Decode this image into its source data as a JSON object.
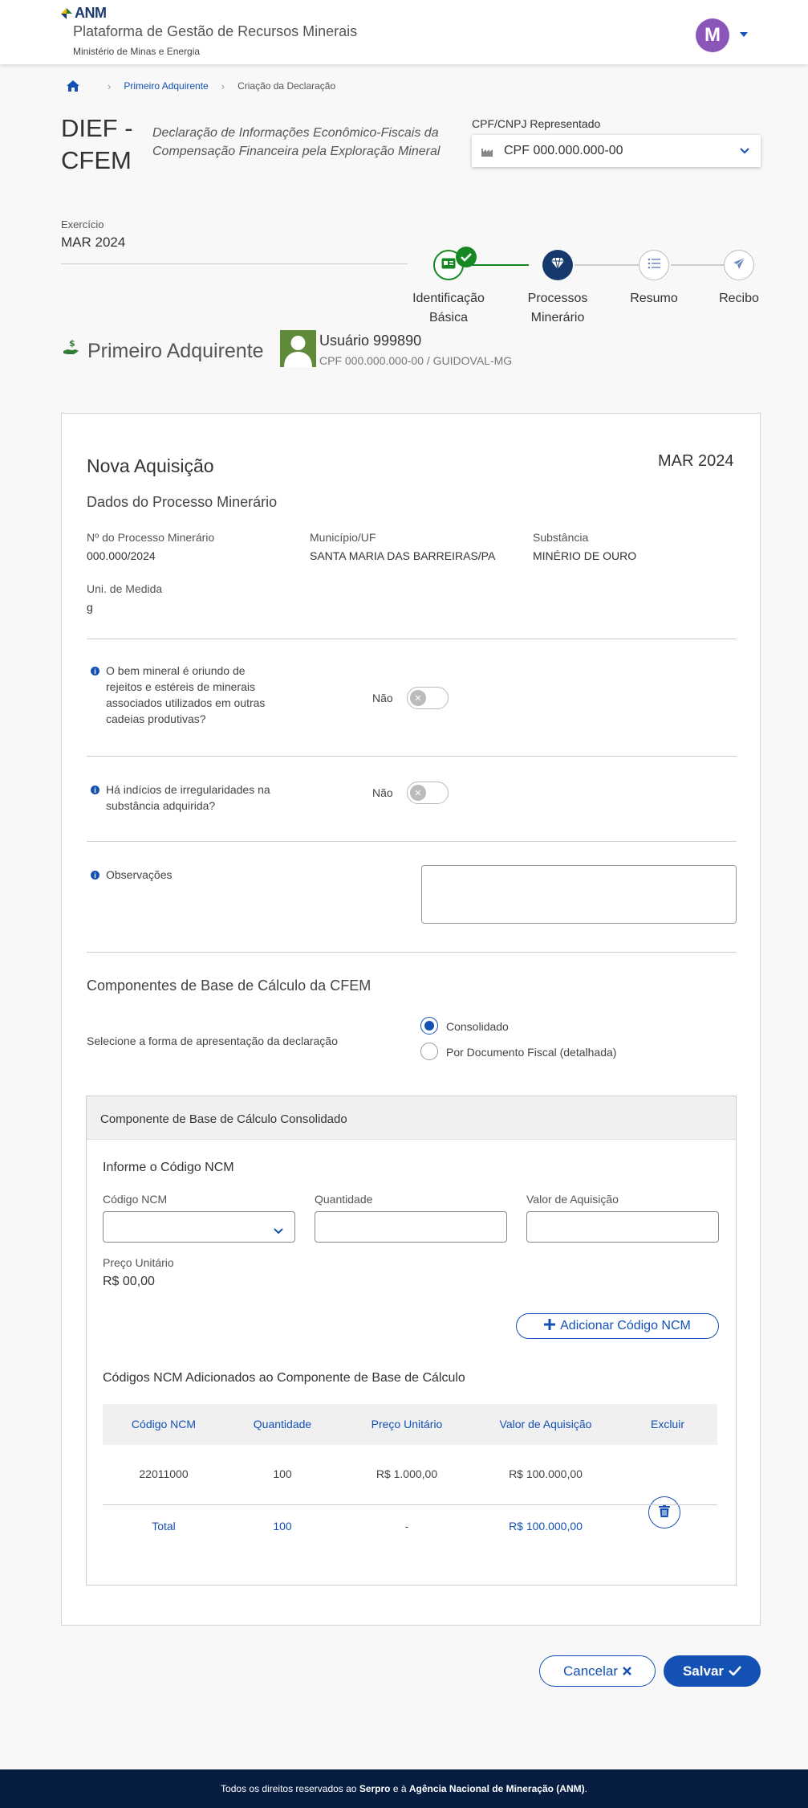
{
  "header": {
    "logo_text": "ANM",
    "platform_title": "Plataforma de Gestão de Recursos Minerais",
    "ministry": "Ministério de Minas e Energia",
    "avatar_initial": "M"
  },
  "breadcrumb": {
    "items": [
      "Primeiro Adquirente",
      "Criação da Declaração"
    ]
  },
  "page": {
    "title": "DIEF - CFEM",
    "description": "Declaração de Informações Econômico-Fiscais da Compensação Financeira pela Exploração Mineral",
    "cpf_label": "CPF/CNPJ Representado",
    "cpf_value": "CPF 000.000.000-00",
    "exercicio_label": "Exercício",
    "exercicio_value": "MAR 2024"
  },
  "stepper": {
    "steps": [
      {
        "line1": "Identificação",
        "line2": "Básica",
        "state": "done"
      },
      {
        "line1": "Processos",
        "line2": "Minerário",
        "state": "active"
      },
      {
        "line1": "Resumo",
        "line2": "",
        "state": "idle"
      },
      {
        "line1": "Recibo",
        "line2": "",
        "state": "idle"
      }
    ]
  },
  "adquirente": {
    "title": "Primeiro Adquirente",
    "user_name": "Usuário 999890",
    "user_cpf": "CPF 000.000.000-00 / GUIDOVAL-MG"
  },
  "form": {
    "title": "Nova Aquisição",
    "period": "MAR 2024",
    "section_title": "Dados do Processo Minerário",
    "processo_label": "Nº do Processo Minerário",
    "processo_value": "000.000/2024",
    "municipio_label": "Município/UF",
    "municipio_value": "SANTA MARIA DAS BARREIRAS/PA",
    "substancia_label": "Substância",
    "substancia_value": "MINÉRIO DE OURO",
    "unidade_label": "Uni. de Medida",
    "unidade_value": "g",
    "q1_lines": [
      "O bem mineral é oriundo de",
      "rejeitos e estéreis de minerais",
      "associados utilizados em outras",
      "cadeias produtivas?"
    ],
    "q1_answer": "Não",
    "q2_lines": [
      "Há indícios de irregularidades na",
      "substância adquirida?"
    ],
    "q2_answer": "Não",
    "obs_label": "Observações",
    "componentes_title": "Componentes de Base de Cálculo da CFEM",
    "forma_label": "Selecione a forma de apresentação da declaração",
    "radio_consolidado": "Consolidado",
    "radio_documento": "Por Documento Fiscal (detalhada)"
  },
  "consolidado": {
    "header": "Componente de Base de Cálculo Consolidado",
    "informe_title": "Informe o Código NCM",
    "codigo_label": "Código NCM",
    "quantidade_label": "Quantidade",
    "valor_label": "Valor de Aquisição",
    "preco_label": "Preço Unitário",
    "preco_value": "R$ 00,00",
    "add_button": "Adicionar Código NCM",
    "table_title": "Códigos NCM Adicionados ao Componente de Base de Cálculo",
    "columns": [
      "Código NCM",
      "Quantidade",
      "Preço Unitário",
      "Valor de Aquisição",
      "Excluir"
    ],
    "row": [
      "22011000",
      "100",
      "R$ 1.000,00",
      "R$ 100.000,00"
    ],
    "total": [
      "Total",
      "100",
      "-",
      "R$ 100.000,00"
    ]
  },
  "actions": {
    "cancel": "Cancelar",
    "save": "Salvar"
  },
  "footer": {
    "prefix": "Todos os direitos reservados ao",
    "serpro": "Serpro",
    "middle": "e à",
    "anm": "Agência Nacional de Mineração (ANM)",
    "suffix": "."
  },
  "colors": {
    "primary": "#1351b4",
    "dark_blue": "#16396d",
    "success": "#168821",
    "avatar": "#8a56b8",
    "footer": "#071d41"
  },
  "icons": [
    "home-icon",
    "factory-icon",
    "chevron-down-icon",
    "id-card-icon",
    "diamond-icon",
    "list-icon",
    "send-icon",
    "check-icon",
    "hand-money-icon",
    "info-icon",
    "close-icon",
    "plus-icon",
    "trash-icon"
  ]
}
